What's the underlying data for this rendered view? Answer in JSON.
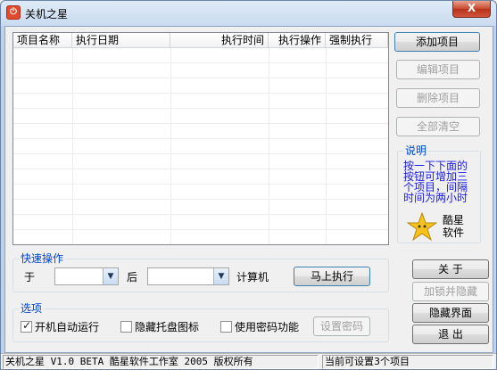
{
  "window": {
    "title": "关机之星",
    "icon": "power-icon",
    "close_label": "X"
  },
  "task_list": {
    "columns": [
      "项目名称",
      "执行日期",
      "执行时间",
      "执行操作",
      "强制执行"
    ],
    "rows": []
  },
  "right_panel": {
    "add_button": "添加项目",
    "edit_button": "编辑项目",
    "delete_button": "删除项目",
    "clear_button": "全部清空"
  },
  "description": {
    "label": "说明",
    "text": "按一下下面的按钮可增加三个项目，间隔时间为两小时",
    "brand_line1": "酷星",
    "brand_line2": "软件",
    "logo_icon": "star-icon"
  },
  "quick_ops": {
    "label": "快速操作",
    "prefix": "于",
    "after_label": "后",
    "computer_label": "计算机",
    "time_value": "",
    "action_value": "",
    "execute_button": "马上执行"
  },
  "options": {
    "label": "选项",
    "autorun_label": "开机自动运行",
    "autorun_checked": true,
    "hide_tray_label": "隐藏托盘图标",
    "hide_tray_checked": false,
    "password_label": "使用密码功能",
    "password_checked": false,
    "set_password_button": "设置密码"
  },
  "side_buttons": {
    "about": "关  于",
    "lock_hide": "加锁并隐藏",
    "hide_ui": "隐藏界面",
    "exit": "退  出"
  },
  "statusbar": {
    "left": "关机之星 V1.0 BETA 酷星软件工作室 2005 版权所有",
    "right": "当前可设置3个项目"
  },
  "colors": {
    "group_label": "#0046d5",
    "description_text": "#1a1aee",
    "close_button": "#c7482f"
  }
}
